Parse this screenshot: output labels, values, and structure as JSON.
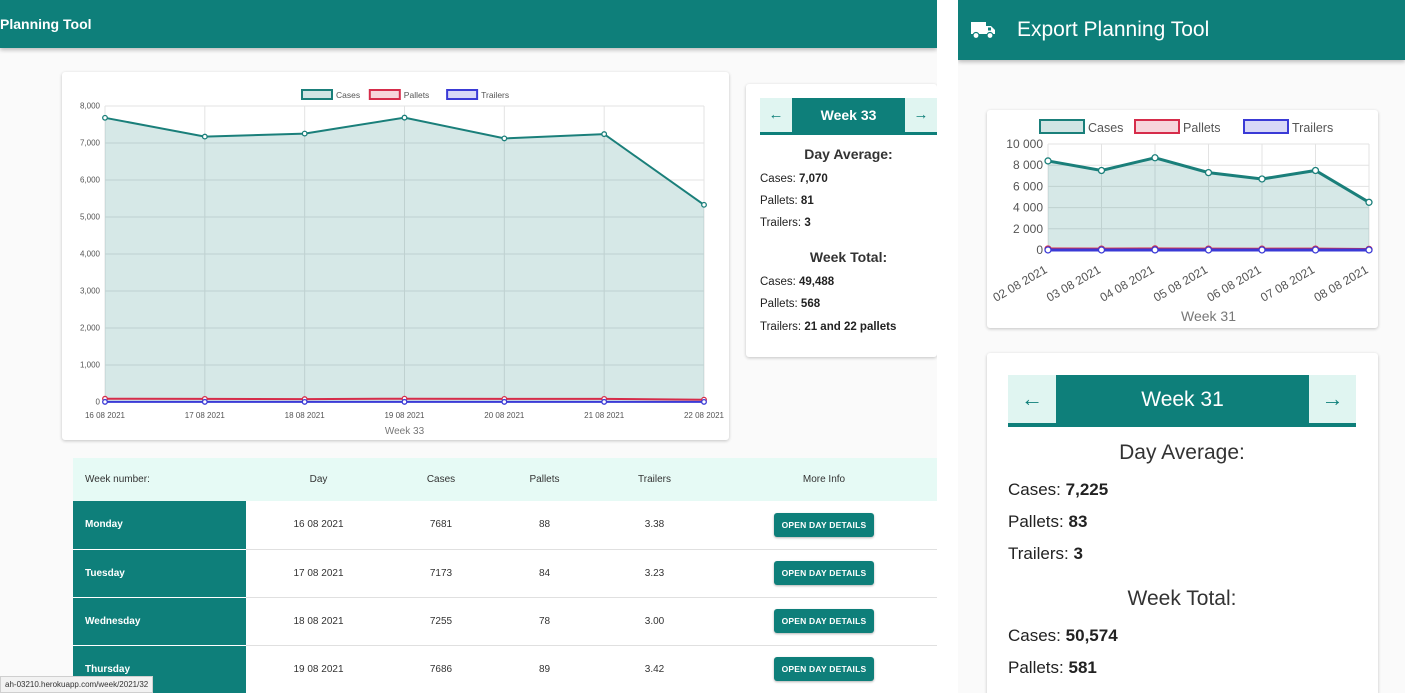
{
  "left": {
    "appbar_title": "Planning Tool",
    "legend": [
      "Cases",
      "Pallets",
      "Trailers"
    ],
    "chart_data": {
      "type": "area",
      "x": [
        "16 08 2021",
        "17 08 2021",
        "18 08 2021",
        "19 08 2021",
        "20 08 2021",
        "21 08 2021",
        "22 08 2021"
      ],
      "series": [
        {
          "name": "Cases",
          "values": [
            7681,
            7173,
            7255,
            7686,
            7124,
            7240,
            5329
          ],
          "color": "#1a7f7a"
        },
        {
          "name": "Pallets",
          "values": [
            88,
            84,
            78,
            89,
            83,
            84,
            62
          ],
          "color": "#d62c4a"
        },
        {
          "name": "Trailers",
          "values": [
            3.38,
            3.23,
            3.0,
            3.42,
            3.2,
            3.3,
            2.4
          ],
          "color": "#3a3ad6"
        }
      ],
      "yticks": [
        "0",
        "1,000",
        "2,000",
        "3,000",
        "4,000",
        "5,000",
        "6,000",
        "7,000",
        "8,000"
      ],
      "ylim": [
        0,
        8000
      ],
      "xlabel": "Week 33",
      "grid": true,
      "legend_position": "top"
    },
    "week_nav": {
      "prev_icon": "←",
      "label": "Week 33",
      "next_icon": "→"
    },
    "day_average": {
      "heading": "Day Average:",
      "cases_label": "Cases:",
      "cases": "7,070",
      "pallets_label": "Pallets:",
      "pallets": "81",
      "trailers_label": "Trailers:",
      "trailers": "3"
    },
    "week_total": {
      "heading": "Week Total:",
      "cases_label": "Cases:",
      "cases": "49,488",
      "pallets_label": "Pallets:",
      "pallets": "568",
      "trailers_label": "Trailers:",
      "trailers": "21 and 22 pallets"
    },
    "table": {
      "headers": [
        "Week number:",
        "Day",
        "Cases",
        "Pallets",
        "Trailers",
        "More Info"
      ],
      "rows": [
        {
          "day": "Monday",
          "date": "16 08 2021",
          "cases": "7681",
          "pallets": "88",
          "trailers": "3.38",
          "action": "OPEN DAY DETAILS"
        },
        {
          "day": "Tuesday",
          "date": "17 08 2021",
          "cases": "7173",
          "pallets": "84",
          "trailers": "3.23",
          "action": "OPEN DAY DETAILS"
        },
        {
          "day": "Wednesday",
          "date": "18 08 2021",
          "cases": "7255",
          "pallets": "78",
          "trailers": "3.00",
          "action": "OPEN DAY DETAILS"
        },
        {
          "day": "Thursday",
          "date": "19 08 2021",
          "cases": "7686",
          "pallets": "89",
          "trailers": "3.42",
          "action": "OPEN DAY DETAILS"
        }
      ]
    },
    "status_url": "ah-03210.herokuapp.com/week/2021/32"
  },
  "right": {
    "appbar_title": "Export Planning Tool",
    "appbar_icon": "truck-icon",
    "legend": [
      "Cases",
      "Pallets",
      "Trailers"
    ],
    "chart_data": {
      "type": "area",
      "x": [
        "02 08 2021",
        "03 08 2021",
        "04 08 2021",
        "05 08 2021",
        "06 08 2021",
        "07 08 2021",
        "08 08 2021"
      ],
      "series": [
        {
          "name": "Cases",
          "values": [
            8400,
            7500,
            8700,
            7300,
            6700,
            7500,
            4500
          ],
          "color": "#1a7f7a"
        },
        {
          "name": "Pallets",
          "values": [
            95,
            85,
            98,
            83,
            76,
            85,
            51
          ],
          "color": "#d62c4a"
        },
        {
          "name": "Trailers",
          "values": [
            3.5,
            3.1,
            3.6,
            3.0,
            2.8,
            3.1,
            1.9
          ],
          "color": "#3a3ad6"
        }
      ],
      "yticks": [
        "0",
        "2 000",
        "4 000",
        "6 000",
        "8 000",
        "10 000"
      ],
      "ylim": [
        0,
        10000
      ],
      "xlabel": "Week 31",
      "grid": true,
      "legend_position": "top"
    },
    "week_nav": {
      "prev_icon": "←",
      "label": "Week 31",
      "next_icon": "→"
    },
    "day_average": {
      "heading": "Day Average:",
      "cases_label": "Cases:",
      "cases": "7,225",
      "pallets_label": "Pallets:",
      "pallets": "83",
      "trailers_label": "Trailers:",
      "trailers": "3"
    },
    "week_total": {
      "heading": "Week Total:",
      "cases_label": "Cases:",
      "cases": "50,574",
      "pallets_label": "Pallets:",
      "pallets": "581"
    }
  }
}
